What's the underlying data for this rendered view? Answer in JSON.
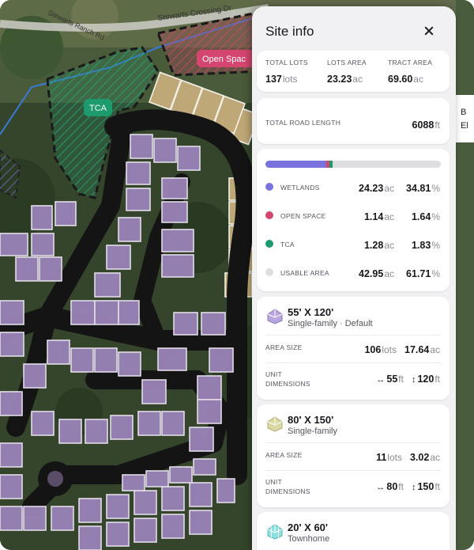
{
  "map": {
    "road_label_1": "Stewarts Crossing Dr",
    "road_label_2": "Stewarts Ranch Rd",
    "tag_tca": "TCA",
    "tag_open_space": "Open Spac",
    "edge_letters": "B\nEl"
  },
  "panel": {
    "title": "Site info",
    "totals": [
      {
        "caption": "TOTAL LOTS",
        "value": "137",
        "unit": "lots"
      },
      {
        "caption": "LOTS AREA",
        "value": "23.23",
        "unit": "ac"
      },
      {
        "caption": "TRACT AREA",
        "value": "69.60",
        "unit": "ac"
      }
    ],
    "road": {
      "caption": "TOTAL ROAD LENGTH",
      "value": "6088",
      "unit": "ft"
    },
    "areas": {
      "bar": [
        {
          "fraction": 0.3481,
          "color": "#7a72dd"
        },
        {
          "fraction": 0.0164,
          "color": "#d4466f"
        },
        {
          "fraction": 0.0183,
          "color": "#1d9b6e"
        },
        {
          "fraction": 0.6171,
          "color": "#dedee2"
        }
      ],
      "rows": [
        {
          "caption": "WETLANDS",
          "color": "#7a72dd",
          "ac": "24.23",
          "ac_unit": "ac",
          "pct": "34.81",
          "pct_unit": "%"
        },
        {
          "caption": "OPEN SPACE",
          "color": "#d4466f",
          "ac": "1.14",
          "ac_unit": "ac",
          "pct": "1.64",
          "pct_unit": "%"
        },
        {
          "caption": "TCA",
          "color": "#1d9b6e",
          "ac": "1.28",
          "ac_unit": "ac",
          "pct": "1.83",
          "pct_unit": "%"
        },
        {
          "caption": "USABLE AREA",
          "color": "#dedee2",
          "ac": "42.95",
          "ac_unit": "ac",
          "pct": "61.71",
          "pct_unit": "%"
        }
      ]
    },
    "lots": [
      {
        "name": "55' X 120'",
        "subtitle": "Single-family  ·  Default",
        "icon": "house-icon",
        "icon_color": "#b7a6de",
        "area_caption": "AREA SIZE",
        "lots_value": "106",
        "lots_unit": "lots",
        "area_value": "17.64",
        "area_unit": "ac",
        "dim_caption_1": "UNIT",
        "dim_caption_2": "DIMENSIONS",
        "width_value": "55",
        "width_unit": "ft",
        "depth_value": "120",
        "depth_unit": "ft"
      },
      {
        "name": "80' X 150'",
        "subtitle": "Single-family",
        "icon": "house-icon",
        "icon_color": "#dcd8a3",
        "area_caption": "AREA SIZE",
        "lots_value": "11",
        "lots_unit": "lots",
        "area_value": "3.02",
        "area_unit": "ac",
        "dim_caption_1": "UNIT",
        "dim_caption_2": "DIMENSIONS",
        "width_value": "80",
        "width_unit": "ft",
        "depth_value": "150",
        "depth_unit": "ft"
      },
      {
        "name": "20' X 60'",
        "subtitle": "Townhome",
        "icon": "townhome-icon",
        "icon_color": "#8ee1e0"
      }
    ]
  }
}
